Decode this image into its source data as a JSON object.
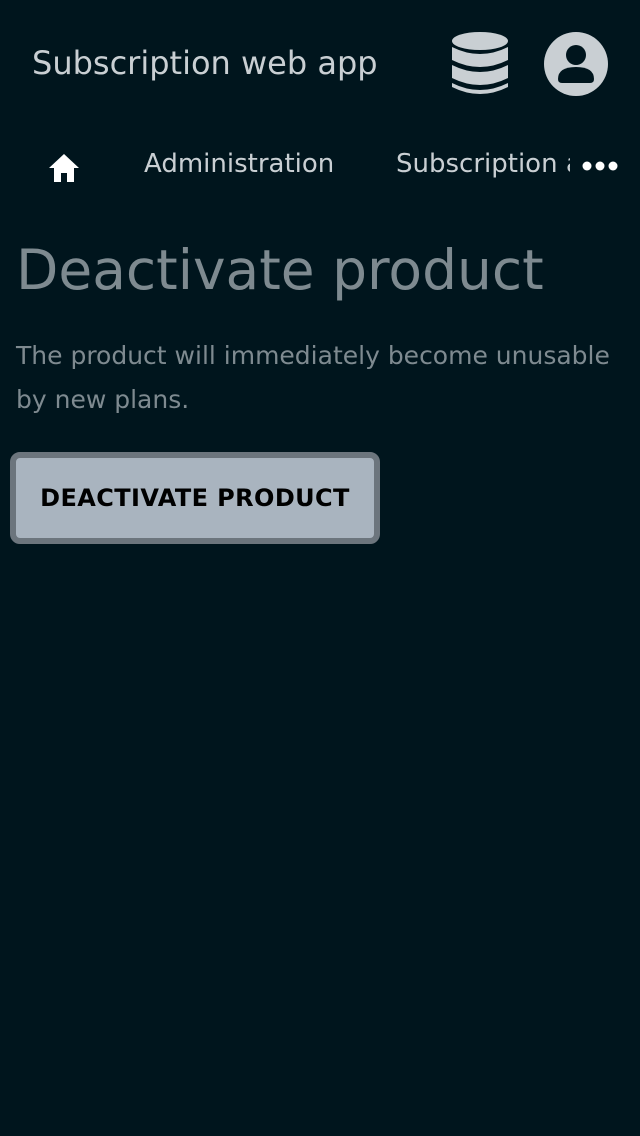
{
  "header": {
    "app_title": "Subscription web app",
    "database_icon": "database-icon",
    "account_icon": "account-circle-icon"
  },
  "breadcrumb": {
    "home_icon": "home-icon",
    "items": [
      {
        "label": "Administration"
      },
      {
        "label": "Subscription and products"
      }
    ],
    "more_icon": "more-horizontal-icon"
  },
  "main": {
    "title": "Deactivate product",
    "description": "The product will immediately become unusable by new plans.",
    "deactivate_button_label": "DEACTIVATE PRODUCT"
  },
  "colors": {
    "background": "#00151d",
    "header_text": "#c9cfd3",
    "muted_text": "#7e8a90",
    "button_fill": "#a9b4bf",
    "button_border": "#6c757d"
  }
}
